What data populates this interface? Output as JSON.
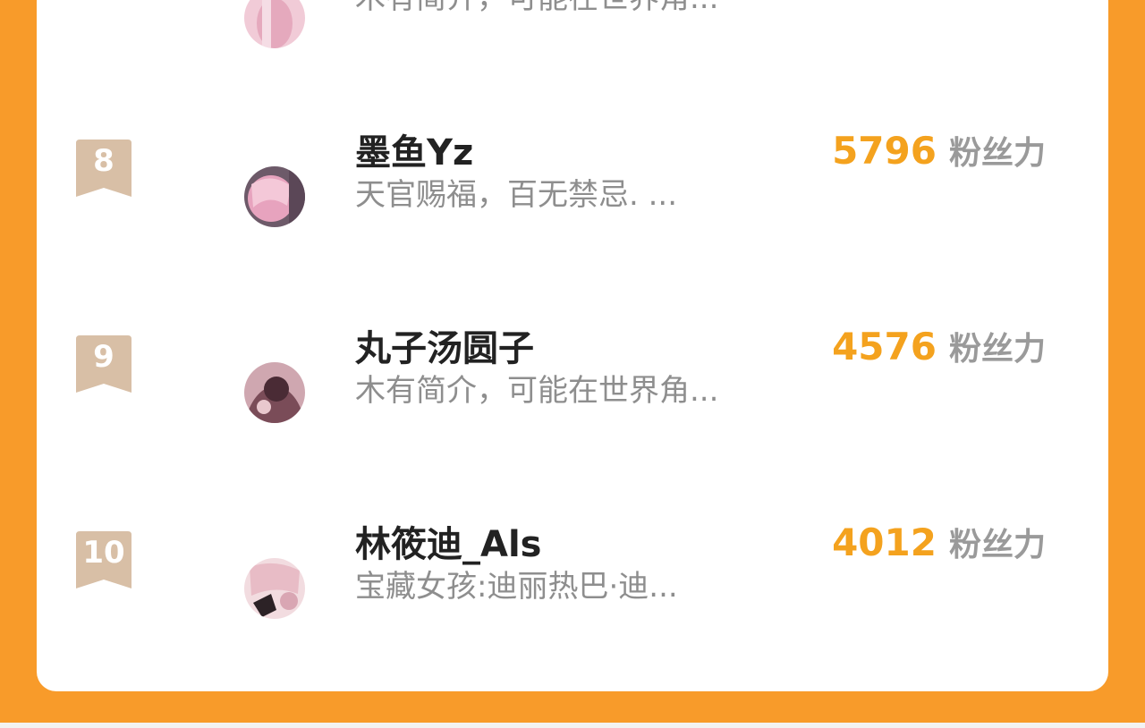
{
  "partial_row": {
    "intro": "木有简介，可能在世界角..."
  },
  "ranking": [
    {
      "rank": "8",
      "name": "墨鱼Yz",
      "intro": "天官赐福，百无禁忌. ...",
      "score": "5796",
      "unit": "粉丝力"
    },
    {
      "rank": "9",
      "name": "丸子汤圆子",
      "intro": "木有简介，可能在世界角...",
      "score": "4576",
      "unit": "粉丝力"
    },
    {
      "rank": "10",
      "name": "林筱迪_Als",
      "intro": "宝藏女孩:迪丽热巴·迪...",
      "score": "4012",
      "unit": "粉丝力"
    }
  ],
  "colors": {
    "background": "#F89B2A",
    "card": "#FFFFFF",
    "badge": "#D8BFA6",
    "score": "#F4A21E",
    "unit": "#9A9A9A",
    "name": "#222222",
    "intro": "#8E8E8E"
  }
}
